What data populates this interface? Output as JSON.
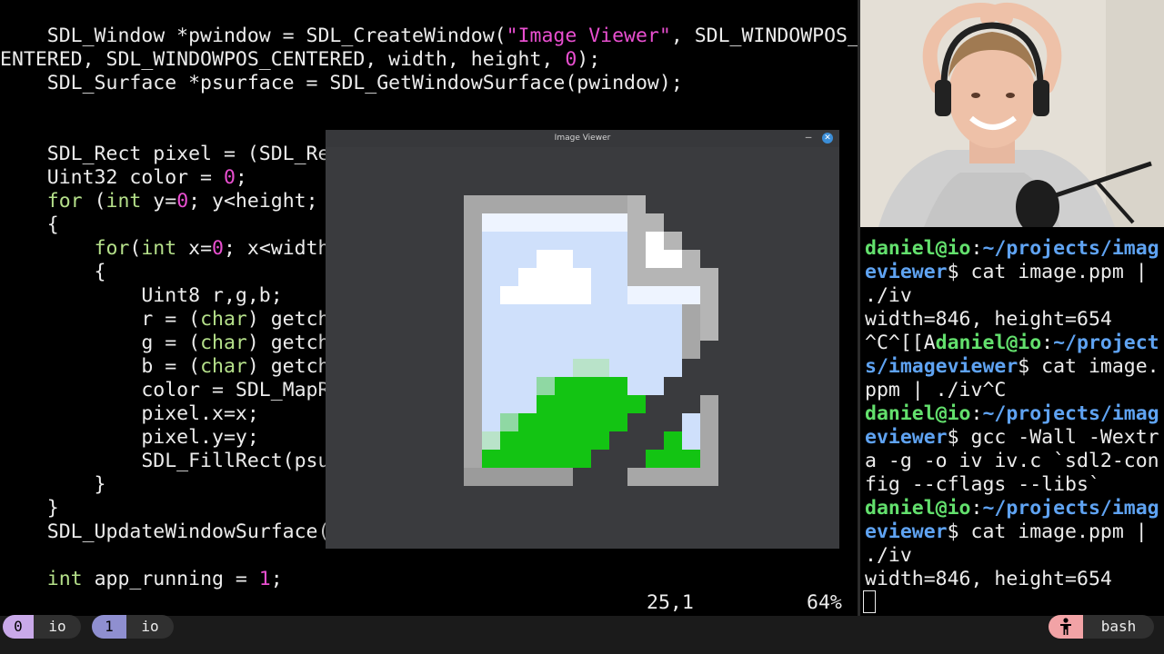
{
  "editor": {
    "code": {
      "l1a": "    SDL_Window *pwindow = SDL_CreateWindow(",
      "l1b": "\"Image Viewer\"",
      "l1c": ", SDL_WINDOWPOS_C",
      "l2a": "ENTERED, SDL_WINDOWPOS_CENTERED, width, height, ",
      "l2b": "0",
      "l2c": ");",
      "l3": "    SDL_Surface *psurface = SDL_GetWindowSurface(pwindow);",
      "l4": "    SDL_Rect pixel = (SDL_Re",
      "l5a": "    Uint32 color = ",
      "l5b": "0",
      "l5c": ";",
      "l6a": "for",
      "l6b": " (",
      "l6c": "int",
      "l6d": " y=",
      "l6e": "0",
      "l6f": "; y<height; ",
      "l7": "    {",
      "l8a": "for",
      "l8b": "(",
      "l8c": "int",
      "l8d": " x=",
      "l8e": "0",
      "l8f": "; x<width",
      "l9": "        {",
      "l10": "            Uint8 r,g,b;",
      "l11a": "            r = (",
      "l11b": "char",
      "l11c": ") getch",
      "l12a": "            g = (",
      "l12b": "char",
      "l12c": ") getch",
      "l13a": "            b = (",
      "l13b": "char",
      "l13c": ") getch",
      "l14": "            color = SDL_MapR",
      "l15": "            pixel.x=x;",
      "l16": "            pixel.y=y;",
      "l17": "            SDL_FillRect(psu",
      "l18": "        }",
      "l19": "    }",
      "l20": "    SDL_UpdateWindowSurface(",
      "l21a": "int",
      "l21b": " app_running = ",
      "l21c": "1",
      "l21d": ";"
    },
    "status": {
      "position": "25,1",
      "percent": "64%"
    }
  },
  "viewer": {
    "title": "Image Viewer",
    "minimize": "–",
    "close": "✕"
  },
  "terminal": {
    "t1u": "daniel@io",
    "t1c": ":",
    "t1p": "~/projects/imag",
    "t2p": "eviewer",
    "t2r": "$ cat image.ppm |",
    "t3": "./iv",
    "t4": "width=846, height=654",
    "t5a": "^C^[[A",
    "t5u": "daniel@io",
    "t5c": ":",
    "t5p": "~/project",
    "t6p": "s/imageviewer",
    "t6r": "$ cat image.",
    "t7": "ppm | ./iv^C",
    "t8u": "daniel@io",
    "t8c": ":",
    "t8p": "~/projects/imag",
    "t9p": "eviewer",
    "t9r": "$ gcc -Wall -Wextr",
    "t10": "a -g -o iv iv.c `sdl2-con",
    "t11": "fig --cflags --libs`",
    "t12u": "daniel@io",
    "t12c": ":",
    "t12p": "~/projects/imag",
    "t13p": "eviewer",
    "t13r": "$ cat image.ppm |",
    "t14": "./iv",
    "t15": "width=846, height=654"
  },
  "tmux": {
    "windows": [
      {
        "index": "0",
        "name": "io"
      },
      {
        "index": "1",
        "name": "io"
      }
    ],
    "session": "bash",
    "session_icon": "person-icon"
  },
  "colors": {
    "keyword": "#b5e08a",
    "string": "#e94fd0",
    "prompt_user": "#63e06d",
    "prompt_path": "#5fa3f2",
    "tmux_active": "#c9a9e9",
    "tmux_session": "#f2a3a6"
  }
}
